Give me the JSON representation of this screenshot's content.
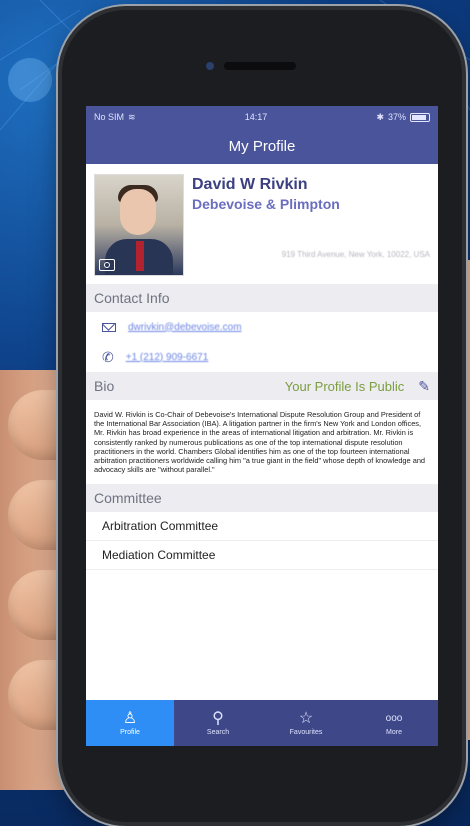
{
  "status": {
    "carrier": "No SIM",
    "time": "14:17",
    "battery": "37%"
  },
  "nav": {
    "title": "My Profile"
  },
  "profile": {
    "name": "David W Rivkin",
    "firm": "Debevoise & Plimpton",
    "address": "919 Third Avenue, New York, 10022, USA"
  },
  "contact": {
    "header": "Contact Info",
    "email": "dwrivkin@debevoise.com",
    "phone": "+1 (212) 909-6671"
  },
  "bio": {
    "header": "Bio",
    "visibility": "Your Profile Is Public",
    "text": "David W. Rivkin is Co-Chair of Debevoise's International Dispute Resolution Group and President of the International Bar Association (IBA). A litigation partner in the firm's New York and London offices, Mr. Rivkin has broad experience in the areas of international litigation and arbitration. Mr. Rivkin is consistently ranked by numerous publications as one of the top international dispute resolution practitioners in the world. Chambers Global identifies him as one of the top fourteen international arbitration practitioners worldwide calling him \"a true giant in the field\" whose depth of knowledge and advocacy skills are \"without parallel.\""
  },
  "committee": {
    "header": "Committee",
    "items": [
      "Arbitration Committee",
      "Mediation Committee"
    ]
  },
  "tabs": [
    {
      "label": "Profile",
      "icon": "person-icon",
      "glyph": "♙"
    },
    {
      "label": "Search",
      "icon": "search-icon",
      "glyph": "⚲"
    },
    {
      "label": "Favourites",
      "icon": "star-icon",
      "glyph": "☆"
    },
    {
      "label": "More",
      "icon": "more-icon",
      "glyph": "ooo"
    }
  ]
}
